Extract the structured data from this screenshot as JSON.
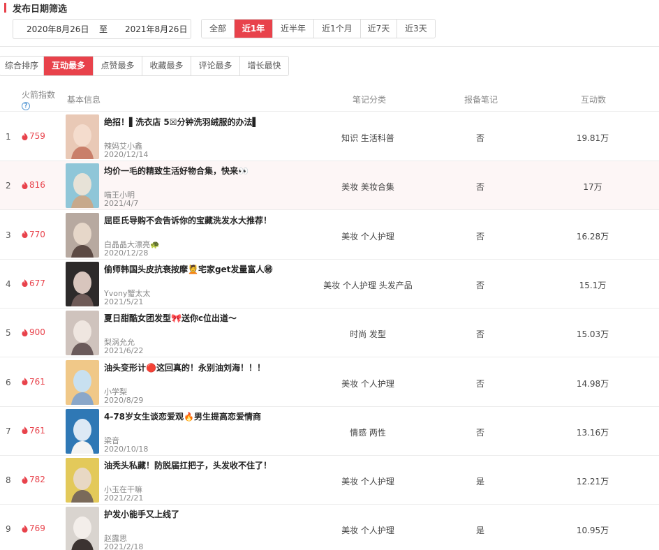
{
  "filter": {
    "section_title": "发布日期筛选",
    "date_start": "2020年8月26日",
    "date_sep": "至",
    "date_end": "2021年8月26日",
    "period_tabs": [
      {
        "label": "全部",
        "active": false
      },
      {
        "label": "近1年",
        "active": true
      },
      {
        "label": "近半年",
        "active": false
      },
      {
        "label": "近1个月",
        "active": false
      },
      {
        "label": "近7天",
        "active": false
      },
      {
        "label": "近3天",
        "active": false
      }
    ]
  },
  "sort_tabs": [
    {
      "label": "综合排序",
      "active": false
    },
    {
      "label": "互动最多",
      "active": true
    },
    {
      "label": "点赞最多",
      "active": false
    },
    {
      "label": "收藏最多",
      "active": false
    },
    {
      "label": "评论最多",
      "active": false
    },
    {
      "label": "增长最快",
      "active": false
    }
  ],
  "table": {
    "headers": {
      "rocket_index": "火箭指数",
      "help_icon": "?",
      "basic_info": "基本信息",
      "category": "笔记分类",
      "reported": "报备笔记",
      "interactions": "互动数"
    },
    "rows": [
      {
        "rank": "1",
        "score": "759",
        "title": "绝招！▌洗衣店 5☒分钟洗羽绒服的办法▌",
        "author": "辣妈艾小鑫",
        "date": "2020/12/14",
        "category": "知识 生活科普",
        "reported": "否",
        "interactions": "19.81万"
      },
      {
        "rank": "2",
        "score": "816",
        "title": "均价一毛的精致生活好物合集，快来👀",
        "author": "喵王小明",
        "date": "2021/4/7",
        "category": "美妆 美妆合集",
        "reported": "否",
        "interactions": "17万"
      },
      {
        "rank": "3",
        "score": "770",
        "title": "屈臣氏导购不会告诉你的宝藏洗发水大推荐！",
        "author": "白晶晶大漂亮🐢",
        "date": "2020/12/28",
        "category": "美妆 个人护理",
        "reported": "否",
        "interactions": "16.28万"
      },
      {
        "rank": "4",
        "score": "677",
        "title": "偷师韩国头皮抗衰按摩💆宅家get发量富人㊙",
        "author": "Yvony蟹太太",
        "date": "2021/5/21",
        "category": "美妆 个人护理 头发产品",
        "reported": "否",
        "interactions": "15.1万"
      },
      {
        "rank": "5",
        "score": "900",
        "title": "夏日甜酷女团发型🎀送你c位出道～",
        "author": "梨涡允允",
        "date": "2021/6/22",
        "category": "时尚 发型",
        "reported": "否",
        "interactions": "15.03万"
      },
      {
        "rank": "6",
        "score": "761",
        "title": "油头变形计🔴这回真的！永别油刘海！！！",
        "author": "小学梨",
        "date": "2020/8/29",
        "category": "美妆 个人护理",
        "reported": "否",
        "interactions": "14.98万"
      },
      {
        "rank": "7",
        "score": "761",
        "title": "4-78岁女生谈恋爱观🔥男生提高恋爱情商",
        "author": "梁音",
        "date": "2020/10/18",
        "category": "情感 两性",
        "reported": "否",
        "interactions": "13.16万"
      },
      {
        "rank": "8",
        "score": "782",
        "title": "油秃头私藏！防脱届扛把子，头发收不住了！",
        "author": "小玉在干嘛",
        "date": "2021/2/21",
        "category": "美妆 个人护理",
        "reported": "是",
        "interactions": "12.21万"
      },
      {
        "rank": "9",
        "score": "769",
        "title": "护发小能手又上线了",
        "author": "赵露思",
        "date": "2021/2/18",
        "category": "美妆 个人护理",
        "reported": "是",
        "interactions": "10.95万"
      }
    ]
  },
  "colors": {
    "accent": "#e8424b",
    "row_highlight": "#fdf6f6",
    "help_icon": "#5b9bd5"
  },
  "icons": {
    "flame": "flame-icon",
    "help": "help-circle-icon"
  }
}
